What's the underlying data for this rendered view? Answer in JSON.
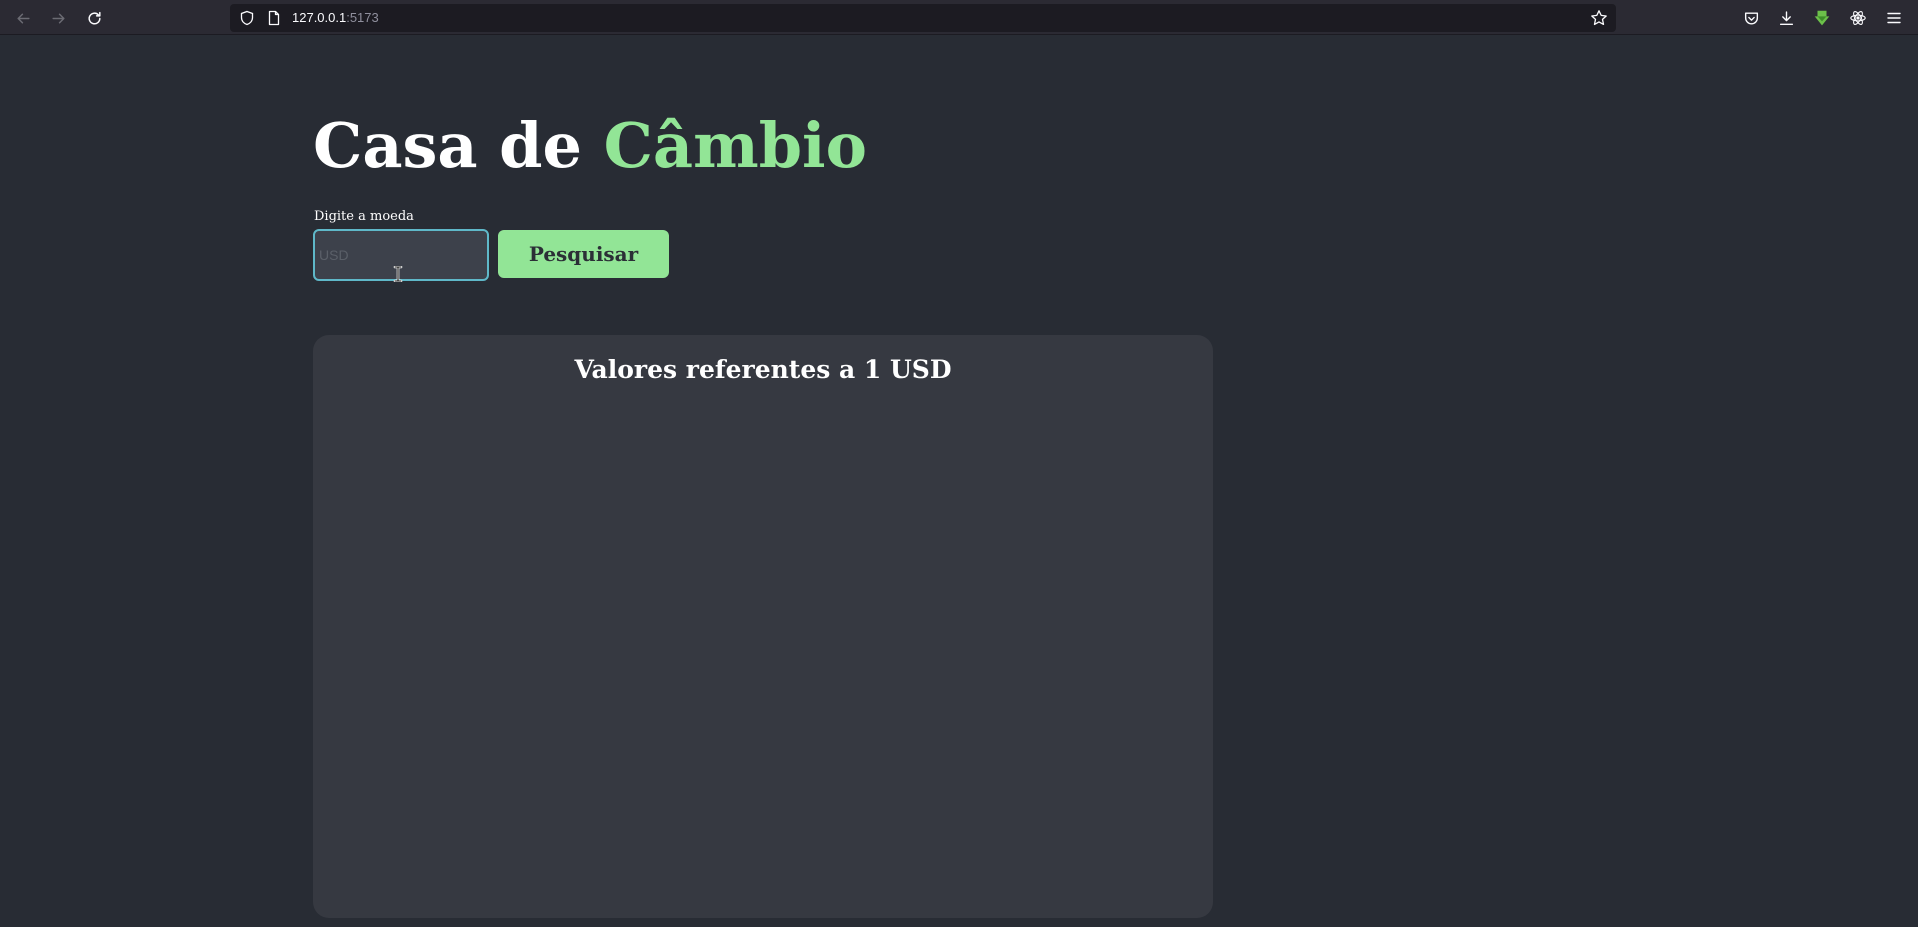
{
  "browser": {
    "url_host": "127.0.0.1",
    "url_port": ":5173",
    "icons": [
      "back-icon",
      "forward-icon",
      "reload-icon",
      "shield-icon",
      "page-icon",
      "bookmark-star-icon",
      "pocket-icon",
      "download-icon",
      "extension-icon",
      "react-devtools-icon",
      "menu-icon"
    ]
  },
  "app": {
    "title_prefix": "Casa de ",
    "title_accent": "Câmbio",
    "input_label": "Digite a moeda",
    "input_value": "",
    "input_placeholder": "USD",
    "search_label": "Pesquisar",
    "results_title": "Valores referentes a 1 USD"
  },
  "colors": {
    "background": "#282c34",
    "accent": "#92e596",
    "panel": "#363941",
    "input_focus_border": "#5fb8c9"
  }
}
